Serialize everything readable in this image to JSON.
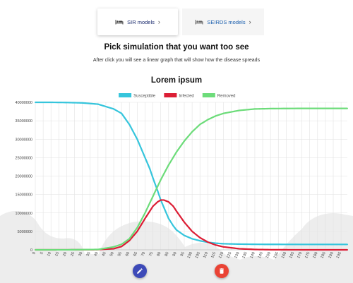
{
  "tabs": [
    {
      "label": "SIR models",
      "icon": "bed-icon",
      "chevron": "chevron-right-icon",
      "active": true
    },
    {
      "label": "SEIRDS models",
      "icon": "bed-icon",
      "chevron": "chevron-right-icon",
      "active": false
    }
  ],
  "header": {
    "title": "Pick simulation that you want too see",
    "subtitle": "After click you will see a linear graph that will show how the disease spreads"
  },
  "actions": {
    "edit_icon": "pencil-icon",
    "delete_icon": "trash-icon",
    "edit_color": "#3d4ab8",
    "delete_color": "#ea4335"
  },
  "chart_data": {
    "type": "line",
    "title": "Lorem ipsum",
    "legend_position": "top-center",
    "grid": true,
    "xlim": [
      0,
      199
    ],
    "ylim": [
      0,
      40000000
    ],
    "ytick_labels": [
      "0",
      "5000000",
      "10000000",
      "15000000",
      "20000000",
      "25000000",
      "30000000",
      "35000000",
      "40000000"
    ],
    "xtick_step": 5,
    "series": [
      {
        "name": "Susceptible",
        "color": "#36c5dc",
        "x": [
          0,
          10,
          20,
          30,
          40,
          50,
          55,
          60,
          65,
          70,
          73,
          75,
          78,
          80,
          83,
          85,
          88,
          90,
          95,
          100,
          105,
          110,
          115,
          120,
          130,
          140,
          150,
          170,
          199
        ],
        "values": [
          40000000,
          40000000,
          39950000,
          39850000,
          39500000,
          38200000,
          37000000,
          34000000,
          30000000,
          25000000,
          22000000,
          19500000,
          16000000,
          13500000,
          10500000,
          8500000,
          6500000,
          5400000,
          3900000,
          3000000,
          2450000,
          2050000,
          1800000,
          1650000,
          1550000,
          1500000,
          1480000,
          1470000,
          1470000
        ]
      },
      {
        "name": "Infected",
        "color": "#dc1e35",
        "x": [
          0,
          20,
          40,
          50,
          55,
          60,
          65,
          70,
          75,
          78,
          80,
          82,
          85,
          88,
          90,
          95,
          100,
          105,
          110,
          115,
          120,
          130,
          140,
          150,
          170,
          199
        ],
        "values": [
          0,
          10000,
          60000,
          300000,
          900000,
          2500000,
          5000000,
          8500000,
          11800000,
          13000000,
          13500000,
          13500000,
          13000000,
          11800000,
          10500000,
          7500000,
          5000000,
          3300000,
          2100000,
          1300000,
          800000,
          300000,
          100000,
          30000,
          5000,
          0
        ]
      },
      {
        "name": "Removed",
        "color": "#6ddc7a",
        "x": [
          0,
          20,
          40,
          50,
          55,
          60,
          65,
          70,
          75,
          80,
          85,
          90,
          95,
          100,
          105,
          110,
          115,
          120,
          130,
          140,
          150,
          170,
          199
        ],
        "values": [
          0,
          10000,
          100000,
          800000,
          1500000,
          3000000,
          6000000,
          10000000,
          14500000,
          19000000,
          23000000,
          26500000,
          29500000,
          32000000,
          34000000,
          35300000,
          36300000,
          37000000,
          37800000,
          38200000,
          38300000,
          38350000,
          38350000
        ]
      }
    ]
  }
}
